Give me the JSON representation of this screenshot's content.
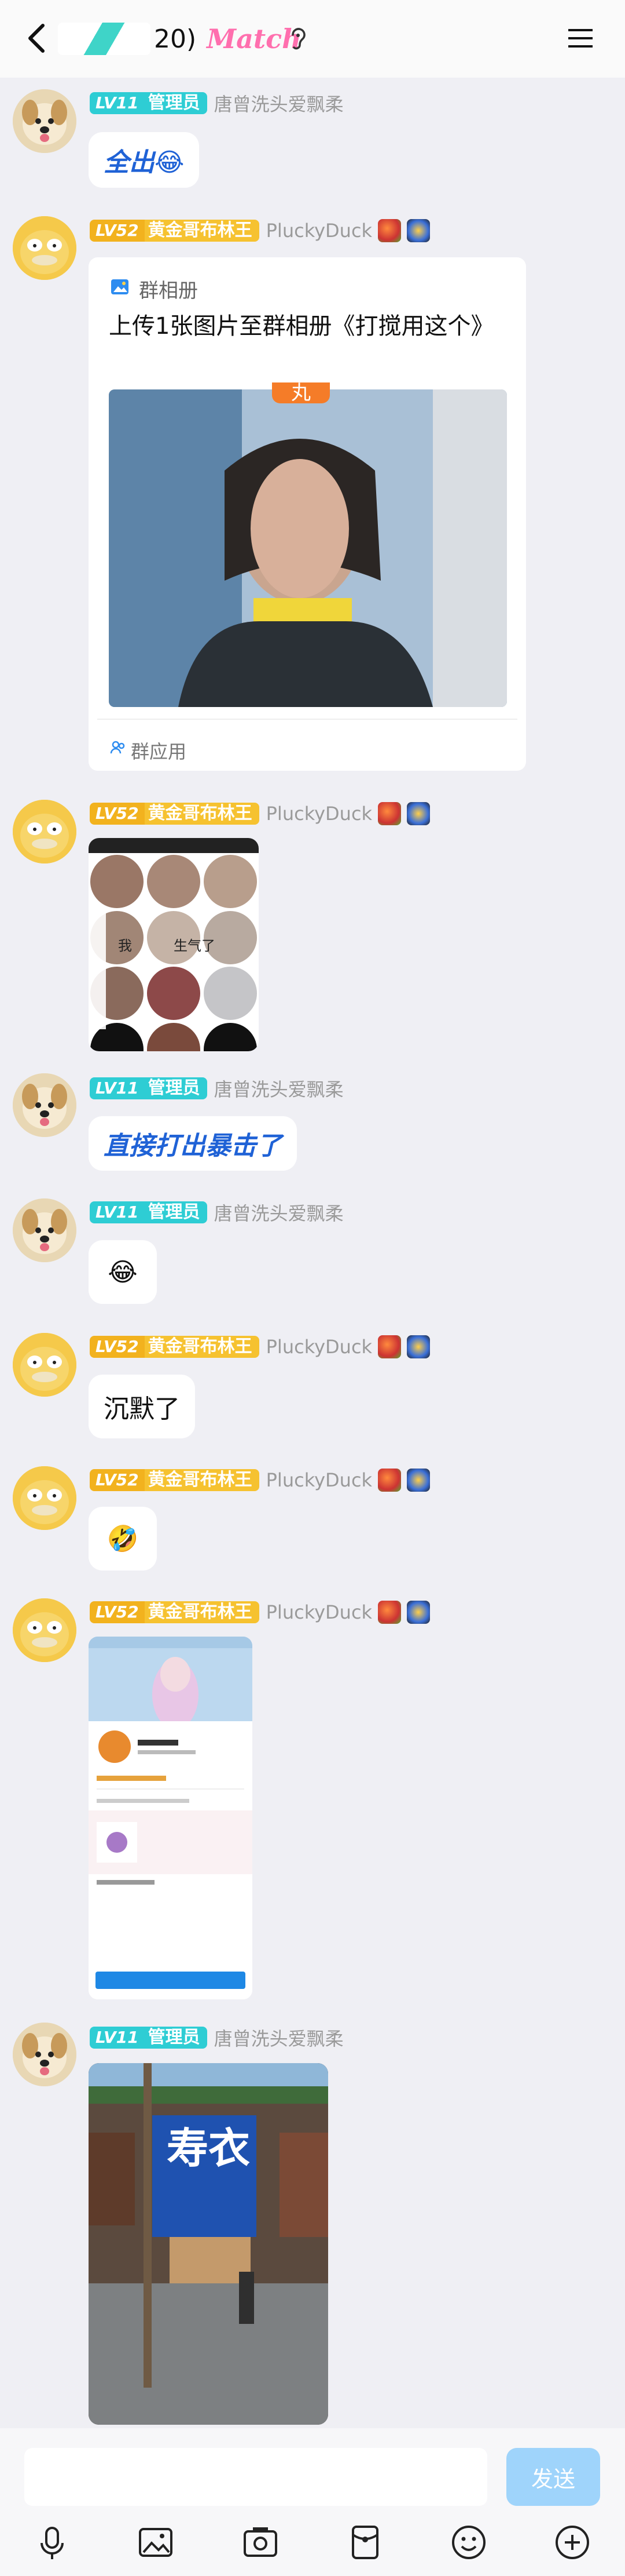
{
  "header": {
    "title_count": "20)",
    "title_brand": "Match"
  },
  "users": {
    "admin": {
      "level": "LV11",
      "title": "管理员",
      "name": "唐曾洗头爱飘柔"
    },
    "duck": {
      "level": "LV52",
      "title": "黄金哥布林王",
      "name": "PluckyDuck"
    }
  },
  "messages": {
    "m1": "全出😂",
    "m5": "直接打出暴击了",
    "m6": "😂",
    "m7": "沉默了",
    "m8": "🤣"
  },
  "album_card": {
    "source": "群相册",
    "text": "上传1张图片至群相册《打搅用这个》",
    "photo_caption": "丸",
    "footer": "群应用"
  },
  "sticker": {
    "left_word": "我",
    "right_word": "生气了"
  },
  "shop_sign": "寿衣",
  "input": {
    "placeholder": "",
    "send_label": "发送"
  },
  "colors": {
    "admin_badge": "#2ecdd4",
    "duck_badge": "#f6c230",
    "send_button": "#9fd4fb",
    "link_blue": "#1f62d6"
  }
}
